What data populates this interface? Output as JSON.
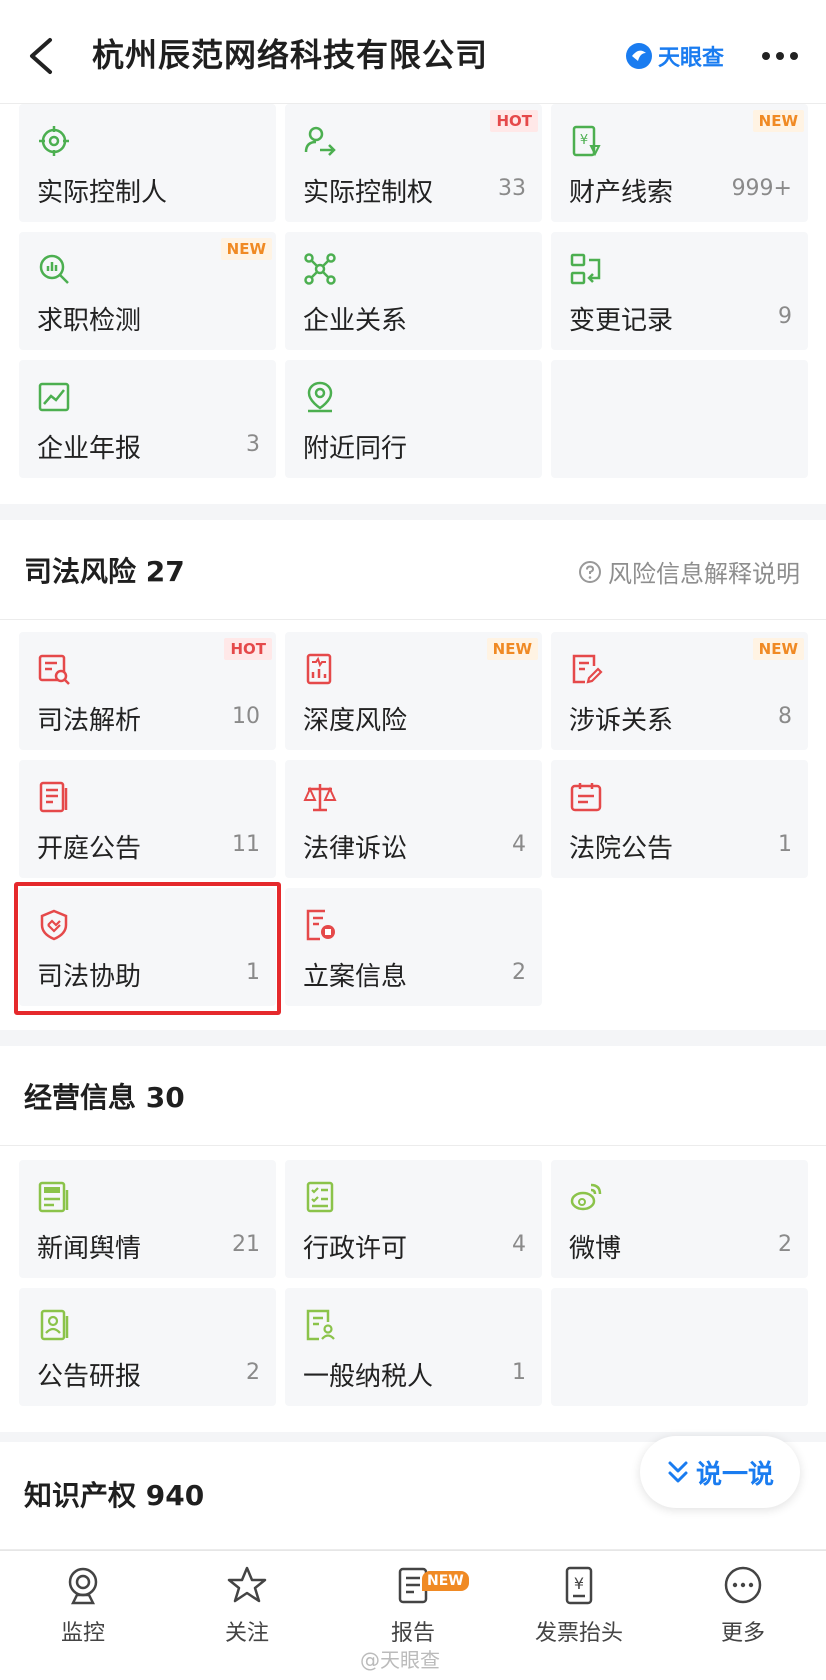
{
  "header": {
    "title": "杭州辰范网络科技有限公司",
    "brand": "天眼查"
  },
  "top_grid": [
    {
      "label": "实际控制人",
      "count": "",
      "badge": ""
    },
    {
      "label": "实际控制权",
      "count": "33",
      "badge": "HOT"
    },
    {
      "label": "财产线索",
      "count": "999+",
      "badge": "NEW"
    },
    {
      "label": "求职检测",
      "count": "",
      "badge": "NEW"
    },
    {
      "label": "企业关系",
      "count": "",
      "badge": ""
    },
    {
      "label": "变更记录",
      "count": "9",
      "badge": ""
    },
    {
      "label": "企业年报",
      "count": "3",
      "badge": ""
    },
    {
      "label": "附近同行",
      "count": "",
      "badge": ""
    }
  ],
  "judicial": {
    "title": "司法风险 27",
    "help": "风险信息解释说明",
    "items": [
      {
        "label": "司法解析",
        "count": "10",
        "badge": "HOT"
      },
      {
        "label": "深度风险",
        "count": "",
        "badge": "NEW"
      },
      {
        "label": "涉诉关系",
        "count": "8",
        "badge": "NEW"
      },
      {
        "label": "开庭公告",
        "count": "11",
        "badge": ""
      },
      {
        "label": "法律诉讼",
        "count": "4",
        "badge": ""
      },
      {
        "label": "法院公告",
        "count": "1",
        "badge": ""
      },
      {
        "label": "司法协助",
        "count": "1",
        "badge": ""
      },
      {
        "label": "立案信息",
        "count": "2",
        "badge": ""
      }
    ]
  },
  "business": {
    "title": "经营信息 30",
    "items": [
      {
        "label": "新闻舆情",
        "count": "21",
        "badge": ""
      },
      {
        "label": "行政许可",
        "count": "4",
        "badge": ""
      },
      {
        "label": "微博",
        "count": "2",
        "badge": ""
      },
      {
        "label": "公告研报",
        "count": "2",
        "badge": ""
      },
      {
        "label": "一般纳税人",
        "count": "1",
        "badge": ""
      }
    ]
  },
  "ip": {
    "title": "知识产权 940"
  },
  "float_button": {
    "label": "说一说"
  },
  "tabbar": {
    "items": [
      {
        "label": "监控"
      },
      {
        "label": "关注"
      },
      {
        "label": "报告",
        "badge": "NEW"
      },
      {
        "label": "发票抬头"
      },
      {
        "label": "更多"
      }
    ]
  },
  "watermark": "@天眼查",
  "colors": {
    "green": "#4caf50",
    "red": "#e5494a",
    "blue": "#1a7cf0",
    "orange": "#f08a24"
  }
}
